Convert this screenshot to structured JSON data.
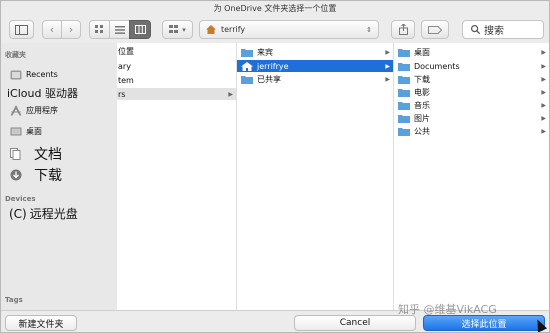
{
  "window": {
    "title": "为 OneDrive 文件夹选择一个位置"
  },
  "toolbar": {
    "path_folder": "terrify",
    "search_label": "搜索"
  },
  "sidebar": {
    "favorites_header": "收藏夹",
    "favorites": [
      {
        "label": "Recents",
        "icon": "recents-icon"
      },
      {
        "label": "iCloud 驱动器",
        "icon": "icloud-icon"
      },
      {
        "label": "应用程序",
        "icon": "applications-icon"
      },
      {
        "label": "桌面",
        "icon": "desktop-icon"
      },
      {
        "label": "文档",
        "icon": "documents-icon"
      },
      {
        "label": "下载",
        "icon": "downloads-icon"
      }
    ],
    "devices_header": "Devices",
    "devices": [
      {
        "label": "远程光盘"
      }
    ],
    "tags_header": "Tags"
  },
  "columns": {
    "col1": [
      "位置",
      "ary",
      "tem",
      "rs"
    ],
    "col2": [
      "来宾",
      "jerrifrye",
      "已共享"
    ],
    "col3": [
      "桌面",
      "Documents",
      "下载",
      "电影",
      "音乐",
      "图片",
      "公共"
    ]
  },
  "footer": {
    "new_folder": "新建文件夹",
    "cancel": "Cancel",
    "choose": "选择此位置",
    "watermark": "知乎 @维基VikACG"
  },
  "colors": {
    "accent": "#1f6fd8",
    "folder": "#5aa0dc",
    "primary_button": "#1d74e8"
  }
}
